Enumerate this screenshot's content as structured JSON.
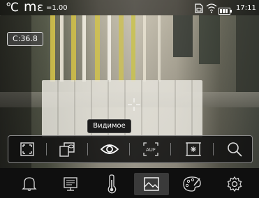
{
  "status": {
    "temp_unit": "℃",
    "mode_letter": "m",
    "emissivity_symbol": "ε",
    "emissivity_value": "=1.00",
    "time": "17:11"
  },
  "overlay": {
    "center_temp": "C:36.8",
    "tooltip": "Видимое"
  },
  "toolbar": {
    "items": [
      {
        "name": "full-frame-icon"
      },
      {
        "name": "overlay-camera-icon"
      },
      {
        "name": "visible-eye-icon"
      },
      {
        "name": "auf-icon",
        "label": "AUF"
      },
      {
        "name": "hotspot-tracking-icon"
      },
      {
        "name": "zoom-search-icon"
      }
    ],
    "active": "visible-eye-icon"
  },
  "bottombar": {
    "items": [
      "bell-icon",
      "monitor-icon",
      "thermometer-icon",
      "image-icon",
      "palette-icon",
      "settings-gear-icon"
    ],
    "active": "image-icon"
  },
  "colors": {
    "toolbar_border": "#8a8a8a",
    "active_bg": "#3a3a3a"
  }
}
